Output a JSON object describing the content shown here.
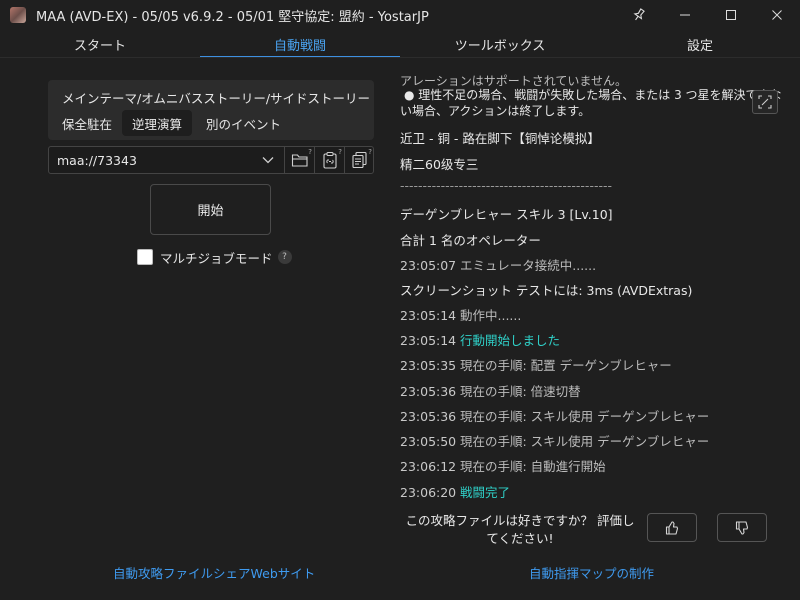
{
  "window": {
    "title": "MAA (AVD-EX) - 05/05 v6.9.2 - 05/01 堅守協定: 盟約 - YostarJP",
    "controls": {
      "pin": "⚲",
      "minimize": "—",
      "maximize": "☐",
      "close": "✕"
    }
  },
  "tabs": [
    {
      "label": "スタート"
    },
    {
      "label": "自動戦闘"
    },
    {
      "label": "ツールボックス"
    },
    {
      "label": "設定"
    }
  ],
  "theme": {
    "title": "メインテーマ/オムニバスストーリー/サイドストーリー",
    "modes": [
      {
        "label": "保全駐在"
      },
      {
        "label": "逆理演算"
      },
      {
        "label": "別のイベント"
      }
    ]
  },
  "file": {
    "value": "maa://73343",
    "badges": {
      "open": "?",
      "paste": "?",
      "batch": "?"
    }
  },
  "start_label": "開始",
  "multi_job": {
    "label": "マルチジョブモード",
    "help": "?"
  },
  "log": {
    "partial_top": "アレーションはサポートされていません。",
    "bullet": "● 理性不足の場合、戦闘が失敗した場合、または 3 つ星を解決できな",
    "bullet_cont": "い場合、アクションは終了します。",
    "stage": "近卫 - 铜 - 路在脚下【铜悼论模拟】",
    "elite": "精二60级专三",
    "divider": "-----------------------------------------------",
    "operator": "デーゲンブレヒャー スキル 3 [Lv.10]",
    "total": "合計 1 名のオペレーター",
    "entries": [
      {
        "time": "23:05:07",
        "msg": "エミュレータ接続中......",
        "hl": false
      },
      {
        "time": "",
        "msg": "スクリーンショット テストには: 3ms (AVDExtras)",
        "hl": false
      },
      {
        "time": "23:05:14",
        "msg": "動作中......",
        "hl": false
      },
      {
        "time": "23:05:14",
        "msg": "行動開始しました",
        "hl": true
      },
      {
        "time": "23:05:35",
        "msg": "現在の手順: 配置 デーゲンブレヒャー",
        "hl": false
      },
      {
        "time": "23:05:36",
        "msg": "現在の手順: 倍速切替",
        "hl": false
      },
      {
        "time": "23:05:36",
        "msg": "現在の手順: スキル使用 デーゲンブレヒャー",
        "hl": false
      },
      {
        "time": "23:05:50",
        "msg": "現在の手順: スキル使用 デーゲンブレヒャー",
        "hl": false
      },
      {
        "time": "23:06:12",
        "msg": "現在の手順: 自動進行開始",
        "hl": false
      },
      {
        "time": "23:06:20",
        "msg": "戦闘完了",
        "hl": true
      }
    ]
  },
  "rating": {
    "line1": "この攻略ファイルは好きですか？ 評価し",
    "line2": "てください!"
  },
  "links": {
    "share_site": "自動攻略ファイルシェアWebサイト",
    "map_make": "自動指揮マップの制作"
  },
  "colors": {
    "accent": "#3d8fe0",
    "highlight": "#2fd0c8",
    "background": "#1f1f1f",
    "panel": "#2c2c2c"
  }
}
